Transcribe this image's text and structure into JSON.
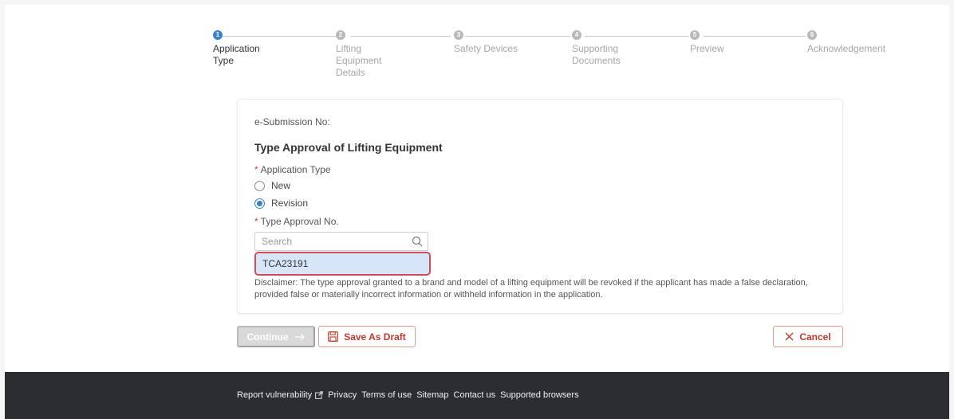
{
  "stepper": {
    "steps": [
      {
        "number": "1",
        "label": "Application Type",
        "active": true
      },
      {
        "number": "2",
        "label": "Lifting Equipment Details",
        "active": false
      },
      {
        "number": "3",
        "label": "Safety Devices",
        "active": false
      },
      {
        "number": "4",
        "label": "Supporting Documents",
        "active": false
      },
      {
        "number": "5",
        "label": "Preview",
        "active": false
      },
      {
        "number": "6",
        "label": "Acknowledgement",
        "active": false
      }
    ]
  },
  "form": {
    "submission_no_label": "e-Submission No:",
    "title": "Type Approval of Lifting Equipment",
    "required_mark": "*",
    "application_type_label": "Application Type",
    "options": [
      {
        "label": "New",
        "checked": false
      },
      {
        "label": "Revision",
        "checked": true
      }
    ],
    "type_approval_label": "Type Approval No.",
    "search": {
      "placeholder": "Search",
      "value": ""
    },
    "dropdown_option": "TCA23191",
    "disclaimer": "Disclaimer: The type approval granted to a brand and model of a lifting equipment will be revoked if the applicant has made a false declaration, provided false or materially incorrect information or withheld information in the application."
  },
  "actions": {
    "continue_label": "Continue",
    "save_draft_label": "Save As Draft",
    "cancel_label": "Cancel"
  },
  "footer": {
    "links": [
      "Report vulnerability",
      "Privacy",
      "Terms of use",
      "Sitemap",
      "Contact us",
      "Supported browsers"
    ]
  },
  "colors": {
    "accent": "#3b82c8",
    "danger": "#c0392b",
    "highlight_border": "#d14b57",
    "footer_bg": "#2b2d31"
  }
}
